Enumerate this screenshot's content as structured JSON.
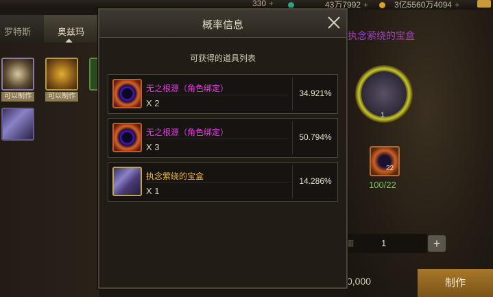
{
  "topbar": {
    "resource1": "330",
    "resource2": "43万7992",
    "resource3": "3亿5560万4094",
    "plus": "+"
  },
  "background": {
    "tabs": [
      "罗特斯",
      "奥兹玛"
    ],
    "item_label": "可以制作",
    "purple_title": "执念萦绕的宝盒",
    "ring_count": "1",
    "material_num": "22",
    "material_count": "100/22",
    "quantity": "1",
    "plus_button": "+",
    "cost_partial": "0,000",
    "make_button": "制作"
  },
  "modal": {
    "title": "概率信息",
    "subtitle": "可获得的道具列表",
    "items": [
      {
        "name": "无之根源（角色绑定）",
        "qty": "X 2",
        "pct": "34.921%"
      },
      {
        "name": "无之根源（角色绑定）",
        "qty": "X 3",
        "pct": "50.794%"
      },
      {
        "name": "执念萦绕的宝盒",
        "qty": "X 1",
        "pct": "14.286%"
      }
    ]
  },
  "colors": {
    "magenta_item": "#e23ce6",
    "gold_item": "#f0b84a",
    "count_green": "#7cc55a"
  }
}
